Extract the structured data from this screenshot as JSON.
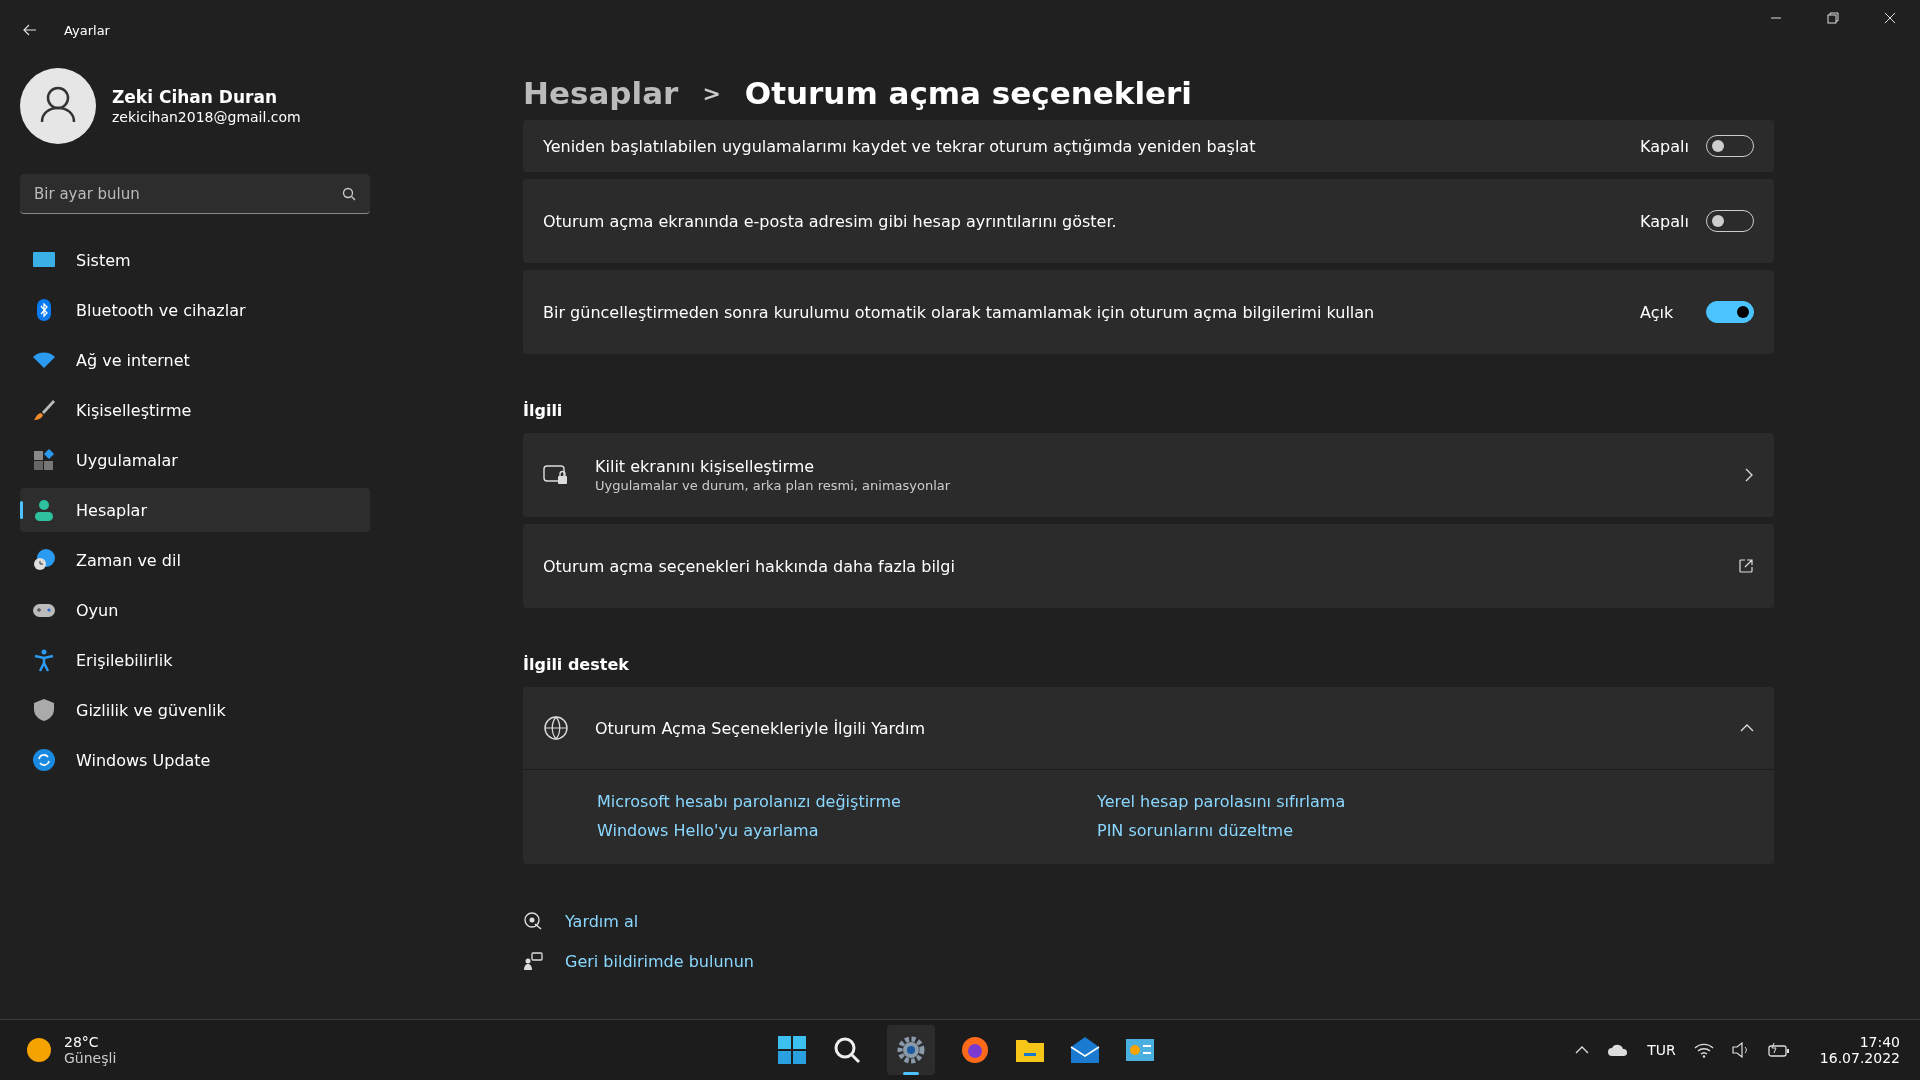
{
  "window": {
    "title": "Ayarlar"
  },
  "user": {
    "name": "Zeki Cihan Duran",
    "email": "zekicihan2018@gmail.com"
  },
  "search": {
    "placeholder": "Bir ayar bulun"
  },
  "sidebar": {
    "items": [
      {
        "label": "Sistem",
        "selected": false
      },
      {
        "label": "Bluetooth ve cihazlar",
        "selected": false
      },
      {
        "label": "Ağ ve internet",
        "selected": false
      },
      {
        "label": "Kişiselleştirme",
        "selected": false
      },
      {
        "label": "Uygulamalar",
        "selected": false
      },
      {
        "label": "Hesaplar",
        "selected": true
      },
      {
        "label": "Zaman ve dil",
        "selected": false
      },
      {
        "label": "Oyun",
        "selected": false
      },
      {
        "label": "Erişilebilirlik",
        "selected": false
      },
      {
        "label": "Gizlilik ve güvenlik",
        "selected": false
      },
      {
        "label": "Windows Update",
        "selected": false
      }
    ]
  },
  "breadcrumb": {
    "parent": "Hesaplar",
    "separator": ">",
    "current": "Oturum açma seçenekleri"
  },
  "settings": [
    {
      "label": "Yeniden başlatılabilen uygulamalarımı kaydet ve tekrar oturum açtığımda yeniden başlat",
      "state": "Kapalı",
      "on": false
    },
    {
      "label": "Oturum açma ekranında e-posta adresim gibi hesap ayrıntılarını göster.",
      "state": "Kapalı",
      "on": false
    },
    {
      "label": "Bir güncelleştirmeden sonra kurulumu otomatik olarak tamamlamak için oturum açma bilgilerimi kullan",
      "state": "Açık",
      "on": true
    }
  ],
  "related": {
    "heading": "İlgili",
    "items": [
      {
        "kind": "nav",
        "title": "Kilit ekranını kişiselleştirme",
        "subtitle": "Uygulamalar ve durum, arka plan resmi, animasyonlar"
      },
      {
        "kind": "external",
        "title": "Oturum açma seçenekleri hakkında daha fazla bilgi"
      }
    ]
  },
  "support": {
    "heading": "İlgili destek",
    "title": "Oturum Açma Seçenekleriyle İlgili Yardım",
    "expanded": true,
    "links": [
      "Microsoft hesabı parolanızı değiştirme",
      "Yerel hesap parolasını sıfırlama",
      "Windows Hello'yu ayarlama",
      "PIN sorunlarını düzeltme"
    ]
  },
  "footer_links": [
    "Yardım al",
    "Geri bildirimde bulunun"
  ],
  "taskbar": {
    "weather": {
      "temp": "28°C",
      "condition": "Güneşli"
    },
    "language": "TUR",
    "time": "17:40",
    "date": "16.07.2022"
  }
}
